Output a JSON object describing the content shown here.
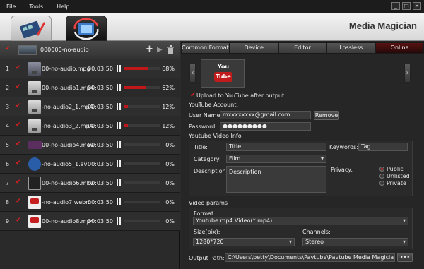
{
  "menu": {
    "file": "File",
    "tools": "Tools",
    "help": "Help"
  },
  "window_buttons": {
    "minimize": "_",
    "maximize": "□",
    "close": "✕"
  },
  "app_title": "Media Magician",
  "toolbar": {
    "project_name": "000000-no-audio",
    "add_icon": "plus-icon",
    "play_icon": "play-icon",
    "delete_icon": "trash-icon"
  },
  "files": [
    {
      "index": "1",
      "name": "00-no-audio.mpg",
      "duration": "00:03:50",
      "progress": 68,
      "percent": "68%",
      "thumb": "mpg"
    },
    {
      "index": "2",
      "name": "00-no-audio1.mp4",
      "duration": "00:03:50",
      "progress": 62,
      "percent": "62%",
      "thumb": "mp4"
    },
    {
      "index": "3",
      "name": "-no-audio2_1.mp4",
      "duration": "00:03:50",
      "progress": 12,
      "percent": "12%",
      "thumb": "mp4"
    },
    {
      "index": "4",
      "name": "-no-audio3_2.mp4",
      "duration": "00:03:50",
      "progress": 12,
      "percent": "12%",
      "thumb": "mp4"
    },
    {
      "index": "5",
      "name": "00-no-audio4.mov",
      "duration": "00:03:50",
      "progress": 0,
      "percent": "0%",
      "thumb": "mov"
    },
    {
      "index": "6",
      "name": "-no-audio5_1.avi",
      "duration": "00:03:50",
      "progress": 0,
      "percent": "0%",
      "thumb": "avi"
    },
    {
      "index": "7",
      "name": "00-no-audio6.mkv",
      "duration": "00:03:50",
      "progress": 0,
      "percent": "0%",
      "thumb": "mkv"
    },
    {
      "index": "8",
      "name": "-no-audio7.webm",
      "duration": "00:03:50",
      "progress": 0,
      "percent": "0%",
      "thumb": "yt"
    },
    {
      "index": "9",
      "name": "00-no-audio8.mp4",
      "duration": "00:03:50",
      "progress": 0,
      "percent": "0%",
      "thumb": "yt"
    }
  ],
  "tabs": [
    "Common Format",
    "Device",
    "Editor",
    "Lossless",
    "Online"
  ],
  "active_tab": "Online",
  "youtube_logo": {
    "you": "You",
    "tube": "Tube"
  },
  "upload": {
    "checkbox_label": "Upload to YouTube after output",
    "account_heading": "YouTube Account:",
    "username_label": "User Name:",
    "username_value": "mxxxxxxxx@gmail.com",
    "remove_label": "Remove",
    "password_label": "Password:",
    "password_value": "●●●●●●●●●",
    "info_heading": "Youtube Video Info",
    "title_label": "Title:",
    "title_value": "Title",
    "keywords_label": "Keywords:",
    "keywords_value": "Tag",
    "category_label": "Category:",
    "category_value": "Film",
    "description_label": "Description:",
    "description_value": "Description",
    "privacy_label": "Privacy:",
    "privacy_options": [
      "Public",
      "Unlisted",
      "Private"
    ],
    "privacy_selected": "Public"
  },
  "video_params": {
    "heading": "Video params",
    "format_label": "Format",
    "format_value": "Youtube mp4 Video(*.mp4)",
    "size_label": "Size(pix):",
    "size_value": "1280*720",
    "channels_label": "Channels:",
    "channels_value": "Stereo"
  },
  "output": {
    "label": "Output Path:",
    "value": "C:\\Users\\betty\\Documents\\Pavtube\\Pavtube Media Magician",
    "browse_label": "•••"
  },
  "colors": {
    "accent_red": "#c01818",
    "active_tab": "#5a1212"
  }
}
